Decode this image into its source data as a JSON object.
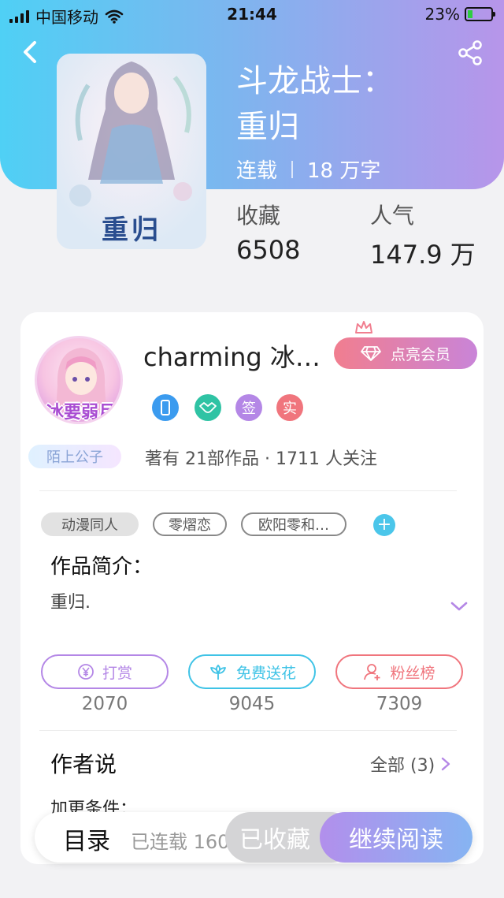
{
  "status_bar": {
    "carrier": "中国移动",
    "time": "21:44",
    "battery": "23%",
    "battery_level": 0.23
  },
  "header": {
    "back_icon": "chevron-left-icon",
    "share_icon": "share-icon"
  },
  "book": {
    "cover_title": "重归",
    "title_line1": "斗龙战士：",
    "title_line2": "重归",
    "status": "连载",
    "word_count": "18 万字",
    "stats": [
      {
        "label": "收藏",
        "value": "6508"
      },
      {
        "label": "人气",
        "value": "147.9 万"
      }
    ]
  },
  "author": {
    "avatar_text": "冰要弱月",
    "name": "charming 冰…",
    "vip_button": "点亮会员",
    "badges": [
      {
        "text": "",
        "icon": "phone-icon",
        "color": "#3b9bef"
      },
      {
        "text": "",
        "icon": "handshake-icon",
        "color": "#2fc3a4"
      },
      {
        "text": "签",
        "icon": "",
        "color": "#b487e6"
      },
      {
        "text": "实",
        "icon": "",
        "color": "#f0757d"
      }
    ],
    "title_tag": "陌上公子",
    "works_info": "著有 21部作品 · 1711 人关注"
  },
  "tags": [
    "动漫同人",
    "零熠恋",
    "欧阳零和…"
  ],
  "intro": {
    "label": "作品简介：",
    "text": "重归."
  },
  "actions": [
    {
      "label": "打赏",
      "icon": "yen-icon",
      "count": "2070",
      "color": "#b487e6"
    },
    {
      "label": "免费送花",
      "icon": "flower-icon",
      "count": "9045",
      "color": "#3fc3e6"
    },
    {
      "label": "粉丝榜",
      "icon": "user-icon",
      "count": "7309",
      "color": "#f0757d"
    }
  ],
  "author_says": {
    "title": "作者说",
    "more": "全部 (3)",
    "first_line": "加更条件："
  },
  "bottom_bar": {
    "toc_label": "目录",
    "toc_status": "已连载 160",
    "favorite_button": "已收藏",
    "read_button": "继续阅读"
  },
  "colors": {
    "header_gradient_start": "#4fd0f5",
    "header_gradient_end": "#b795ea",
    "accent_purple": "#b487e6",
    "accent_cyan": "#3fc3e6",
    "accent_pink": "#f0757d"
  }
}
